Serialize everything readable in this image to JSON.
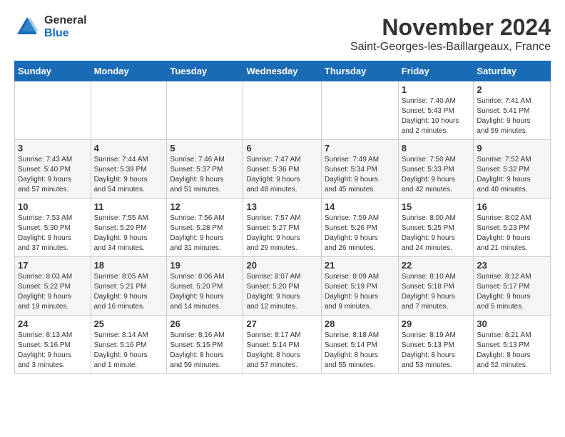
{
  "logo": {
    "general": "General",
    "blue": "Blue"
  },
  "header": {
    "month": "November 2024",
    "location": "Saint-Georges-les-Baillargeaux, France"
  },
  "weekdays": [
    "Sunday",
    "Monday",
    "Tuesday",
    "Wednesday",
    "Thursday",
    "Friday",
    "Saturday"
  ],
  "weeks": [
    [
      {
        "day": "",
        "info": ""
      },
      {
        "day": "",
        "info": ""
      },
      {
        "day": "",
        "info": ""
      },
      {
        "day": "",
        "info": ""
      },
      {
        "day": "",
        "info": ""
      },
      {
        "day": "1",
        "info": "Sunrise: 7:40 AM\nSunset: 5:43 PM\nDaylight: 10 hours\nand 2 minutes."
      },
      {
        "day": "2",
        "info": "Sunrise: 7:41 AM\nSunset: 5:41 PM\nDaylight: 9 hours\nand 59 minutes."
      }
    ],
    [
      {
        "day": "3",
        "info": "Sunrise: 7:43 AM\nSunset: 5:40 PM\nDaylight: 9 hours\nand 57 minutes."
      },
      {
        "day": "4",
        "info": "Sunrise: 7:44 AM\nSunset: 5:39 PM\nDaylight: 9 hours\nand 54 minutes."
      },
      {
        "day": "5",
        "info": "Sunrise: 7:46 AM\nSunset: 5:37 PM\nDaylight: 9 hours\nand 51 minutes."
      },
      {
        "day": "6",
        "info": "Sunrise: 7:47 AM\nSunset: 5:36 PM\nDaylight: 9 hours\nand 48 minutes."
      },
      {
        "day": "7",
        "info": "Sunrise: 7:49 AM\nSunset: 5:34 PM\nDaylight: 9 hours\nand 45 minutes."
      },
      {
        "day": "8",
        "info": "Sunrise: 7:50 AM\nSunset: 5:33 PM\nDaylight: 9 hours\nand 42 minutes."
      },
      {
        "day": "9",
        "info": "Sunrise: 7:52 AM\nSunset: 5:32 PM\nDaylight: 9 hours\nand 40 minutes."
      }
    ],
    [
      {
        "day": "10",
        "info": "Sunrise: 7:53 AM\nSunset: 5:30 PM\nDaylight: 9 hours\nand 37 minutes."
      },
      {
        "day": "11",
        "info": "Sunrise: 7:55 AM\nSunset: 5:29 PM\nDaylight: 9 hours\nand 34 minutes."
      },
      {
        "day": "12",
        "info": "Sunrise: 7:56 AM\nSunset: 5:28 PM\nDaylight: 9 hours\nand 31 minutes."
      },
      {
        "day": "13",
        "info": "Sunrise: 7:57 AM\nSunset: 5:27 PM\nDaylight: 9 hours\nand 29 minutes."
      },
      {
        "day": "14",
        "info": "Sunrise: 7:59 AM\nSunset: 5:26 PM\nDaylight: 9 hours\nand 26 minutes."
      },
      {
        "day": "15",
        "info": "Sunrise: 8:00 AM\nSunset: 5:25 PM\nDaylight: 9 hours\nand 24 minutes."
      },
      {
        "day": "16",
        "info": "Sunrise: 8:02 AM\nSunset: 5:23 PM\nDaylight: 9 hours\nand 21 minutes."
      }
    ],
    [
      {
        "day": "17",
        "info": "Sunrise: 8:03 AM\nSunset: 5:22 PM\nDaylight: 9 hours\nand 19 minutes."
      },
      {
        "day": "18",
        "info": "Sunrise: 8:05 AM\nSunset: 5:21 PM\nDaylight: 9 hours\nand 16 minutes."
      },
      {
        "day": "19",
        "info": "Sunrise: 8:06 AM\nSunset: 5:20 PM\nDaylight: 9 hours\nand 14 minutes."
      },
      {
        "day": "20",
        "info": "Sunrise: 8:07 AM\nSunset: 5:20 PM\nDaylight: 9 hours\nand 12 minutes."
      },
      {
        "day": "21",
        "info": "Sunrise: 8:09 AM\nSunset: 5:19 PM\nDaylight: 9 hours\nand 9 minutes."
      },
      {
        "day": "22",
        "info": "Sunrise: 8:10 AM\nSunset: 5:18 PM\nDaylight: 9 hours\nand 7 minutes."
      },
      {
        "day": "23",
        "info": "Sunrise: 8:12 AM\nSunset: 5:17 PM\nDaylight: 9 hours\nand 5 minutes."
      }
    ],
    [
      {
        "day": "24",
        "info": "Sunrise: 8:13 AM\nSunset: 5:16 PM\nDaylight: 9 hours\nand 3 minutes."
      },
      {
        "day": "25",
        "info": "Sunrise: 8:14 AM\nSunset: 5:16 PM\nDaylight: 9 hours\nand 1 minute."
      },
      {
        "day": "26",
        "info": "Sunrise: 8:16 AM\nSunset: 5:15 PM\nDaylight: 8 hours\nand 59 minutes."
      },
      {
        "day": "27",
        "info": "Sunrise: 8:17 AM\nSunset: 5:14 PM\nDaylight: 8 hours\nand 57 minutes."
      },
      {
        "day": "28",
        "info": "Sunrise: 8:18 AM\nSunset: 5:14 PM\nDaylight: 8 hours\nand 55 minutes."
      },
      {
        "day": "29",
        "info": "Sunrise: 8:19 AM\nSunset: 5:13 PM\nDaylight: 8 hours\nand 53 minutes."
      },
      {
        "day": "30",
        "info": "Sunrise: 8:21 AM\nSunset: 5:13 PM\nDaylight: 8 hours\nand 52 minutes."
      }
    ]
  ]
}
